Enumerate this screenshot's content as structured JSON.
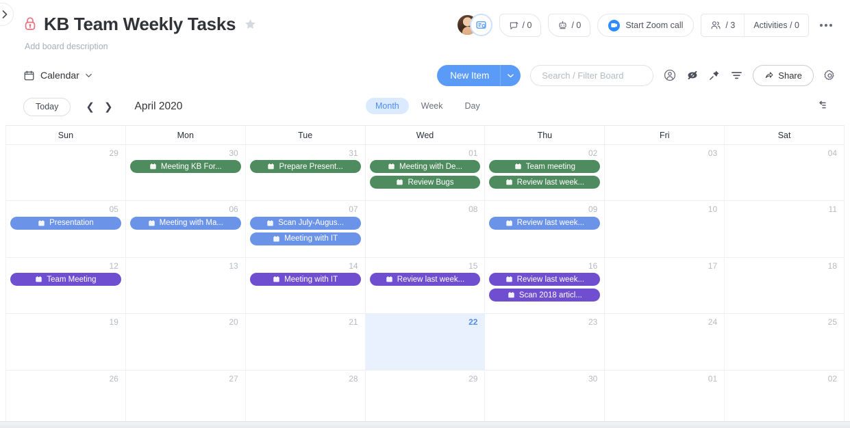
{
  "header": {
    "lock_icon": "lock-icon",
    "title": "KB Team Weekly Tasks",
    "star_icon": "star-icon",
    "description_placeholder": "Add board description",
    "avatar_name": "avatar",
    "avatar_badge_icon": "board-view-icon",
    "updates_count": "/ 0",
    "automations_count": "/ 0",
    "zoom_call_label": "Start Zoom call",
    "members_count": "/ 3",
    "activities_label": "Activities / 0",
    "more_icon": "more-options-icon"
  },
  "toolbar": {
    "view_icon": "calendar-icon",
    "view_label": "Calendar",
    "view_chevron": "chevron-down-icon",
    "new_item_label": "New Item",
    "new_item_chevron": "chevron-down-icon",
    "search_placeholder": "Search / Filter Board",
    "person_icon": "person-filter-icon",
    "hide_icon": "hide-icon",
    "pin_icon": "pin-icon",
    "filter_icon": "filter-icon",
    "share_icon": "share-icon",
    "share_label": "Share",
    "settings_icon": "gear-icon"
  },
  "calendar_nav": {
    "today_label": "Today",
    "prev_icon": "chevron-left-icon",
    "next_icon": "chevron-right-icon",
    "month_label": "April 2020",
    "ranges": [
      {
        "label": "Month",
        "active": true
      },
      {
        "label": "Week",
        "active": false
      },
      {
        "label": "Day",
        "active": false
      }
    ],
    "collapse_icon": "collapse-panel-icon"
  },
  "calendar": {
    "day_headers": [
      "Sun",
      "Mon",
      "Tue",
      "Wed",
      "Thu",
      "Fri",
      "Sat"
    ],
    "event_colors": {
      "green": "#4e8c5f",
      "blue": "#6b93e8",
      "purple": "#6f4fd0"
    },
    "today_highlight_color": "#e8f1fd",
    "weeks": [
      [
        {
          "day": "29",
          "today": false,
          "events": []
        },
        {
          "day": "30",
          "today": false,
          "events": [
            {
              "title": "Meeting KB For...",
              "color": "green",
              "icon": "calendar-item-icon"
            }
          ]
        },
        {
          "day": "31",
          "today": false,
          "events": [
            {
              "title": "Prepare Present...",
              "color": "green",
              "icon": "calendar-item-icon"
            }
          ]
        },
        {
          "day": "01",
          "today": false,
          "events": [
            {
              "title": "Meeting with De...",
              "color": "green",
              "icon": "calendar-item-icon"
            },
            {
              "title": "Review Bugs",
              "color": "green",
              "icon": "calendar-item-icon"
            }
          ]
        },
        {
          "day": "02",
          "today": false,
          "events": [
            {
              "title": "Team meeting",
              "color": "green",
              "icon": "calendar-item-icon"
            },
            {
              "title": "Review last week...",
              "color": "green",
              "icon": "calendar-item-icon"
            }
          ]
        },
        {
          "day": "03",
          "today": false,
          "events": []
        },
        {
          "day": "04",
          "today": false,
          "events": []
        }
      ],
      [
        {
          "day": "05",
          "today": false,
          "events": [
            {
              "title": "Presentation",
              "color": "blue",
              "icon": "calendar-item-icon"
            }
          ]
        },
        {
          "day": "06",
          "today": false,
          "events": [
            {
              "title": "Meeting with Ma...",
              "color": "blue",
              "icon": "calendar-item-icon"
            }
          ]
        },
        {
          "day": "07",
          "today": false,
          "events": [
            {
              "title": "Scan July-Augus...",
              "color": "blue",
              "icon": "calendar-item-icon"
            },
            {
              "title": "Meeting with IT",
              "color": "blue",
              "icon": "calendar-item-icon"
            }
          ]
        },
        {
          "day": "08",
          "today": false,
          "events": []
        },
        {
          "day": "09",
          "today": false,
          "events": [
            {
              "title": "Review last week...",
              "color": "blue",
              "icon": "calendar-item-icon"
            }
          ]
        },
        {
          "day": "10",
          "today": false,
          "events": []
        },
        {
          "day": "11",
          "today": false,
          "events": []
        }
      ],
      [
        {
          "day": "12",
          "today": false,
          "events": [
            {
              "title": "Team Meeting",
              "color": "purple",
              "icon": "calendar-item-icon"
            }
          ]
        },
        {
          "day": "13",
          "today": false,
          "events": []
        },
        {
          "day": "14",
          "today": false,
          "events": [
            {
              "title": "Meeting with IT",
              "color": "purple",
              "icon": "calendar-item-icon"
            }
          ]
        },
        {
          "day": "15",
          "today": false,
          "events": [
            {
              "title": "Review last week...",
              "color": "purple",
              "icon": "calendar-item-icon"
            }
          ]
        },
        {
          "day": "16",
          "today": false,
          "events": [
            {
              "title": "Review last week...",
              "color": "purple",
              "icon": "calendar-item-icon"
            },
            {
              "title": "Scan 2018 articl...",
              "color": "purple",
              "icon": "calendar-item-icon"
            }
          ]
        },
        {
          "day": "17",
          "today": false,
          "events": []
        },
        {
          "day": "18",
          "today": false,
          "events": []
        }
      ],
      [
        {
          "day": "19",
          "today": false,
          "events": []
        },
        {
          "day": "20",
          "today": false,
          "events": []
        },
        {
          "day": "21",
          "today": false,
          "events": []
        },
        {
          "day": "22",
          "today": true,
          "events": []
        },
        {
          "day": "23",
          "today": false,
          "events": []
        },
        {
          "day": "24",
          "today": false,
          "events": []
        },
        {
          "day": "25",
          "today": false,
          "events": []
        }
      ],
      [
        {
          "day": "26",
          "today": false,
          "events": []
        },
        {
          "day": "27",
          "today": false,
          "events": []
        },
        {
          "day": "28",
          "today": false,
          "events": []
        },
        {
          "day": "29",
          "today": false,
          "events": []
        },
        {
          "day": "30",
          "today": false,
          "events": []
        },
        {
          "day": "01",
          "today": false,
          "events": []
        },
        {
          "day": "02",
          "today": false,
          "events": []
        }
      ]
    ]
  }
}
